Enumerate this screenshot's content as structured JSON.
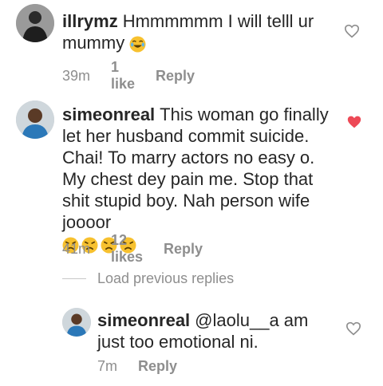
{
  "comments": [
    {
      "username": "illrymz",
      "text": "Hmmmmmm I will telll ur mummy",
      "emoji": [
        "laughing-tears-emoji"
      ],
      "time": "39m",
      "likes": "1 like",
      "reply": "Reply",
      "liked": false
    },
    {
      "username": "simeonreal",
      "text": "This woman go finally let her husband commit suicide. Chai! To marry actors no easy o. My chest dey pain me. Stop that shit stupid boy. Nah person wife joooor",
      "emoji": [
        "angry-face-emoji",
        "angry-face-emoji",
        "angry-face-emoji",
        "angry-face-emoji"
      ],
      "time": "41m",
      "likes": "12 likes",
      "reply": "Reply",
      "liked": true
    },
    {
      "username": "simeonreal",
      "text": "@laolu__a am just too emotional ni.",
      "time": "7m",
      "reply": "Reply",
      "liked": false
    }
  ],
  "load_previous": "Load previous replies",
  "colors": {
    "text": "#262626",
    "meta": "#8e8e8e",
    "heart_liked": "#ed4956",
    "heart_outline": "#8e8e8e",
    "emoji_yellow": "#f7c12f"
  }
}
